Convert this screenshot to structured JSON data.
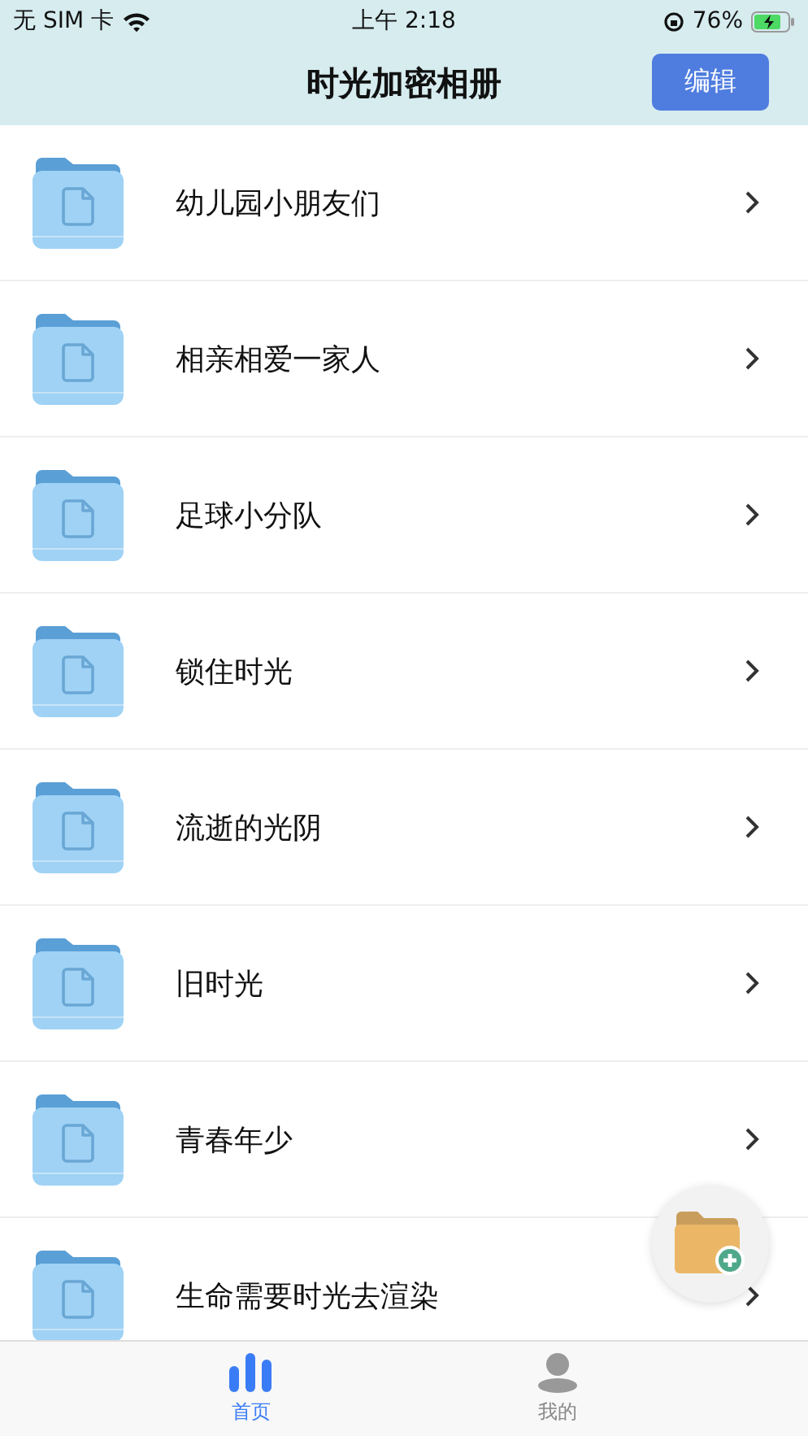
{
  "status_bar": {
    "carrier": "无 SIM 卡",
    "time": "上午 2:18",
    "battery": "76%"
  },
  "header": {
    "title": "时光加密相册",
    "edit_button": "编辑"
  },
  "albums": [
    {
      "name": "幼儿园小朋友们"
    },
    {
      "name": "相亲相爱一家人"
    },
    {
      "name": "足球小分队"
    },
    {
      "name": "锁住时光"
    },
    {
      "name": "流逝的光阴"
    },
    {
      "name": "旧时光"
    },
    {
      "name": "青春年少"
    },
    {
      "name": "生命需要时光去渲染"
    }
  ],
  "tabs": [
    {
      "label": "首页",
      "kind": "home",
      "selected": true
    },
    {
      "label": "我的",
      "kind": "profile",
      "selected": false
    }
  ]
}
